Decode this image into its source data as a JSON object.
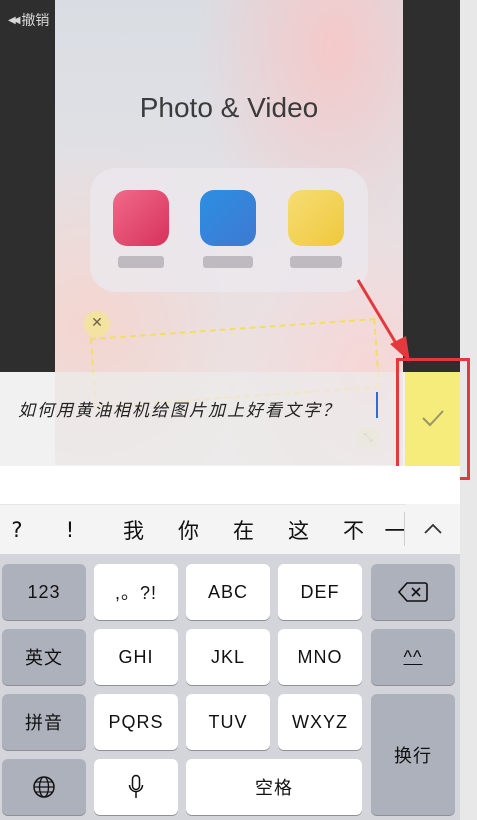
{
  "header": {
    "undo_label": "撤销"
  },
  "folder": {
    "title": "Photo & Video"
  },
  "input": {
    "text": "如何用黄油相机给图片加上好看文字？"
  },
  "candidates": [
    "?",
    "!",
    "我",
    "你",
    "在",
    "这",
    "不",
    "一"
  ],
  "keyboard": {
    "row1": [
      "123",
      ",。?!",
      "ABC",
      "DEF"
    ],
    "row2": [
      "英文",
      "GHI",
      "JKL",
      "MNO",
      "^^"
    ],
    "row3": [
      "拼音",
      "PQRS",
      "TUV",
      "WXYZ"
    ],
    "enter": "换行",
    "space": "空格"
  },
  "colors": {
    "confirm": "#f5ec7c",
    "highlight": "#e4393c",
    "caret": "#2b6fd6"
  },
  "icons": [
    "rewind-icon",
    "close-icon",
    "resize-icon",
    "check-icon",
    "chevron-up-icon",
    "delete-icon",
    "globe-icon",
    "microphone-icon"
  ]
}
